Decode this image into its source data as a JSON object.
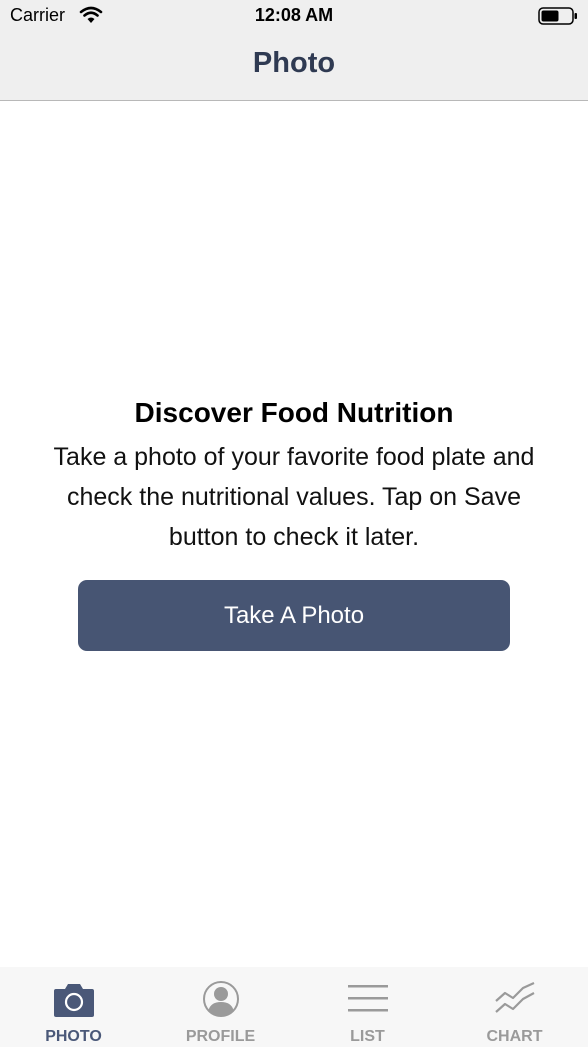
{
  "status_bar": {
    "carrier": "Carrier",
    "time": "12:08 AM",
    "icons": [
      "wifi-icon",
      "battery-icon"
    ]
  },
  "nav": {
    "title": "Photo"
  },
  "main": {
    "heading": "Discover Food Nutrition",
    "description": "Take a photo of your favorite food plate and check the nutritional values. Tap on Save button to check it later.",
    "button_label": "Take A Photo"
  },
  "tabs": [
    {
      "label": "PHOTO",
      "icon": "camera-icon",
      "active": true
    },
    {
      "label": "PROFILE",
      "icon": "profile-icon",
      "active": false
    },
    {
      "label": "LIST",
      "icon": "list-icon",
      "active": false
    },
    {
      "label": "CHART",
      "icon": "chart-icon",
      "active": false
    }
  ],
  "colors": {
    "accent": "#475573",
    "nav_title": "#2f3a52",
    "tab_active": "#4a5878",
    "tab_inactive": "#9a9a9a",
    "bar_background": "#efefef"
  }
}
